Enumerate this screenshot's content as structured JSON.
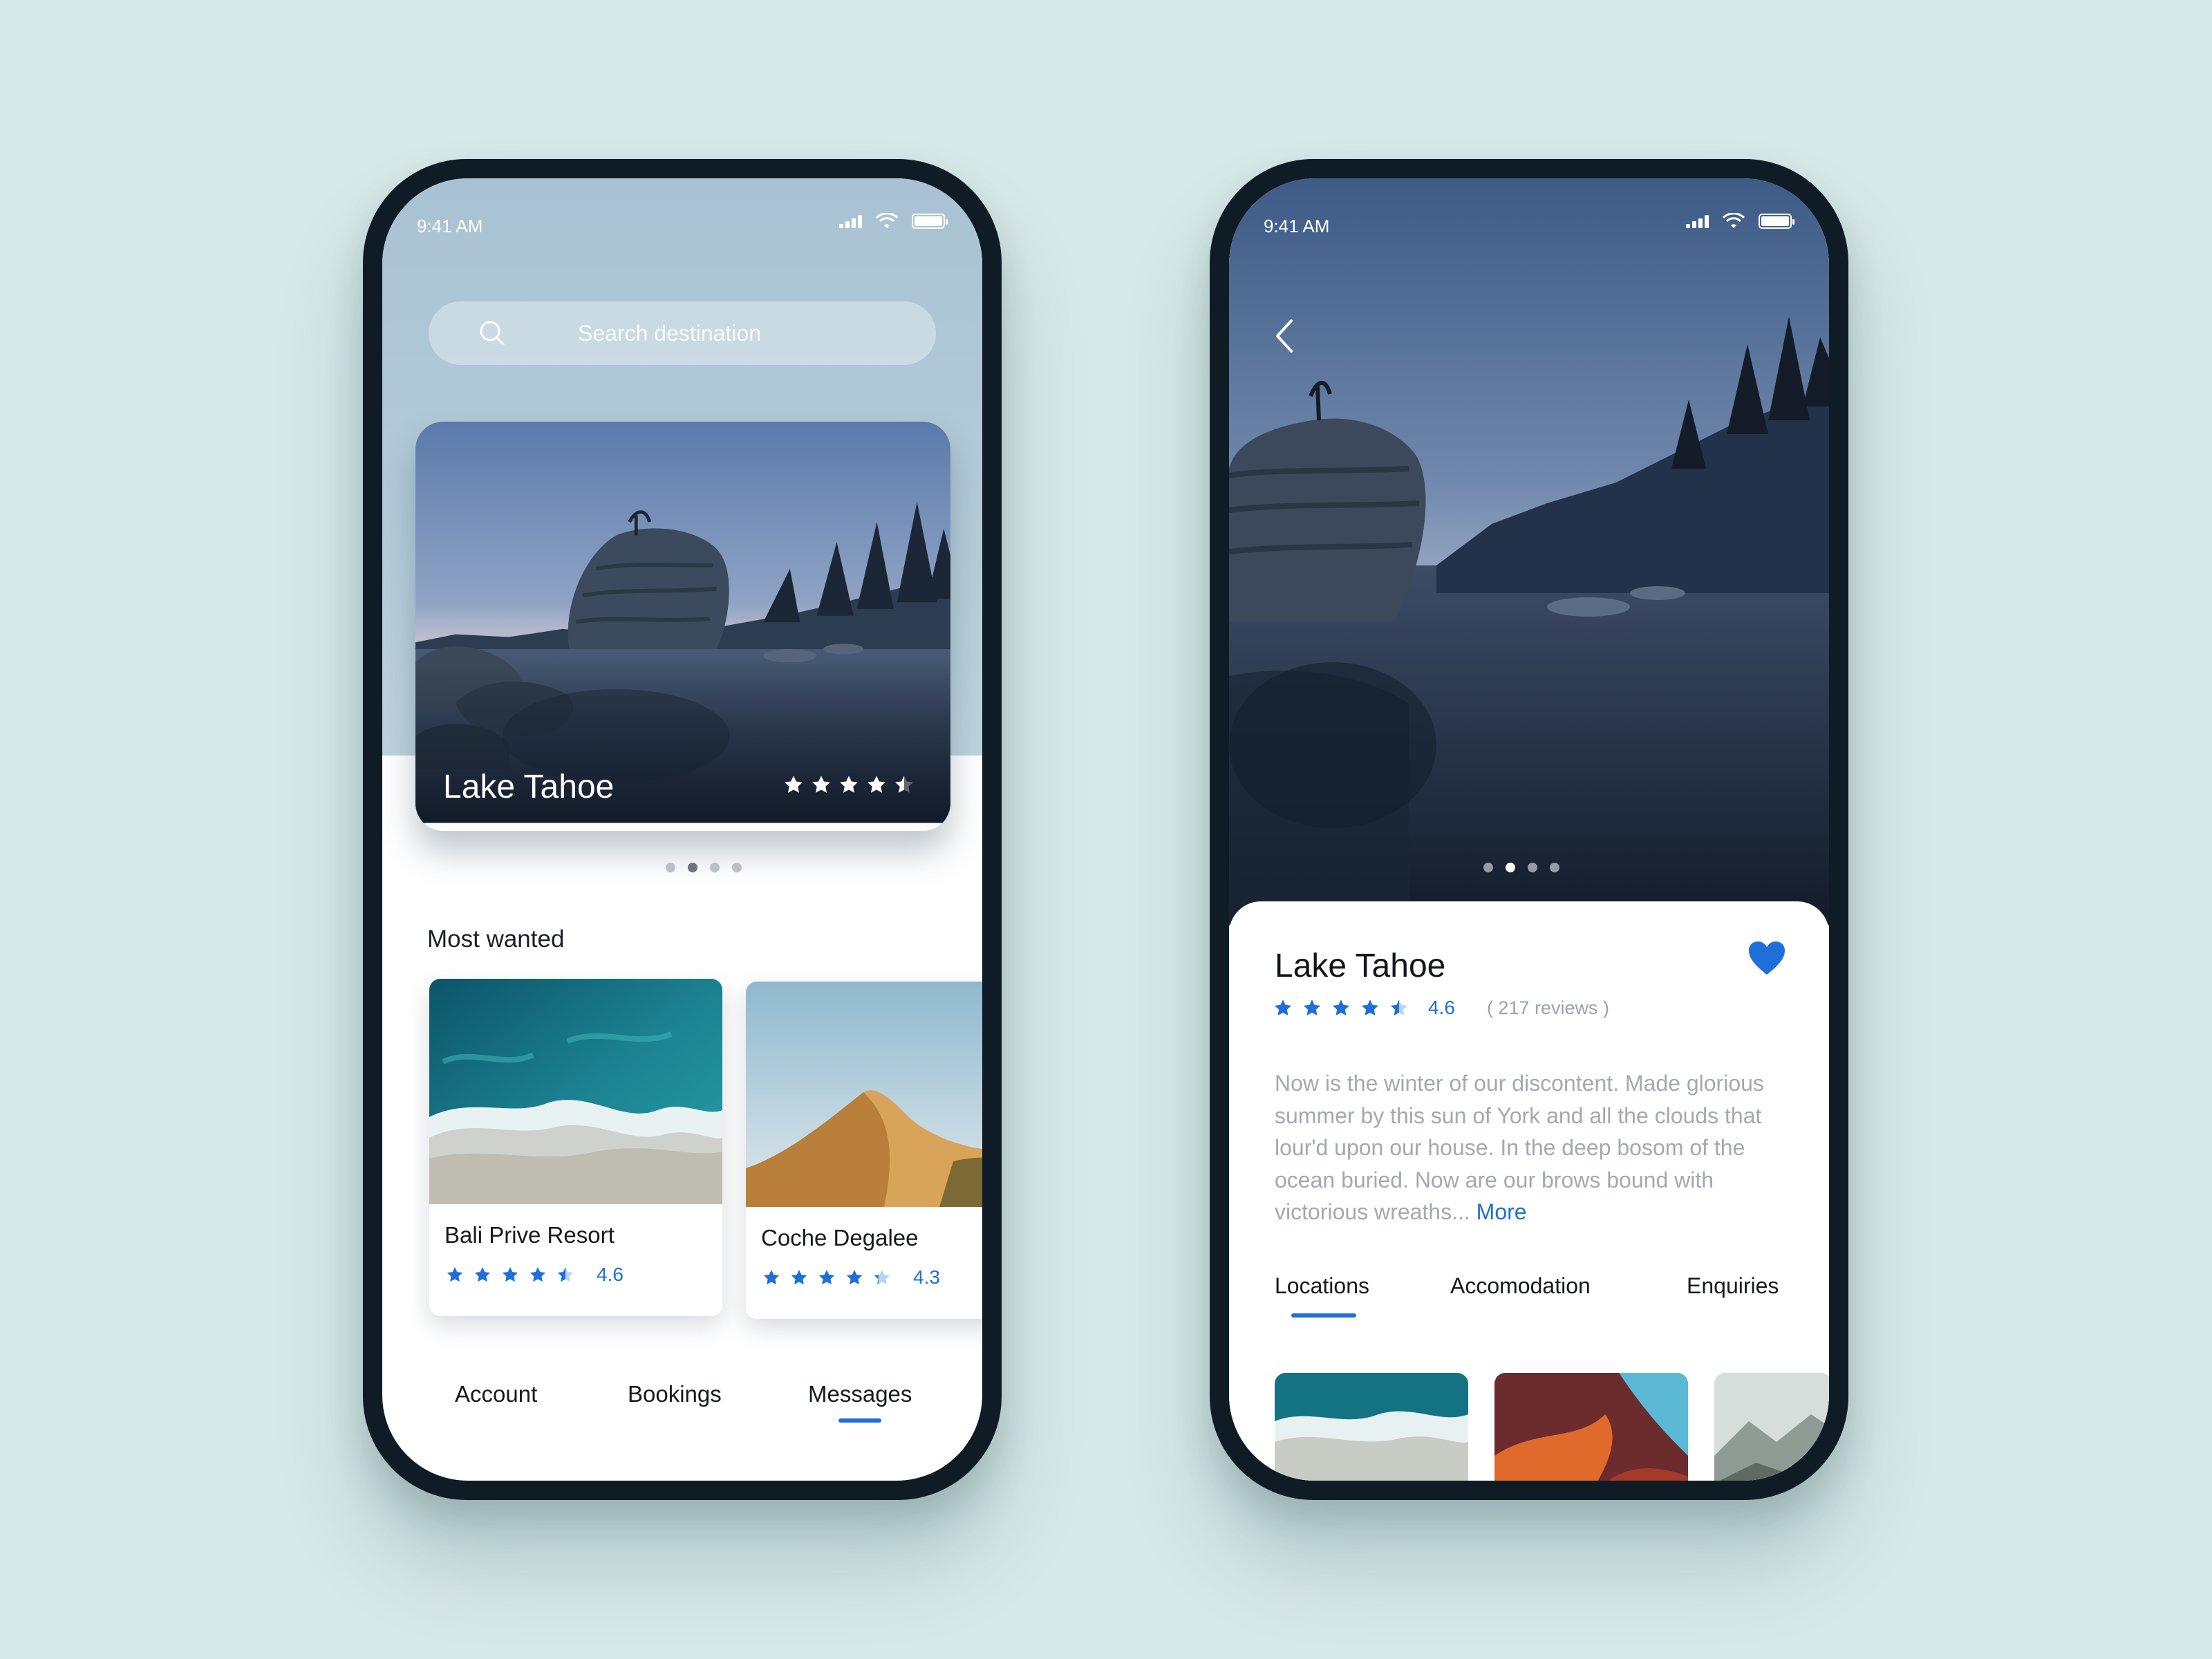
{
  "status": {
    "time": "9:41 AM"
  },
  "home": {
    "search": {
      "placeholder": "Search destination"
    },
    "featured": {
      "title": "Lake Tahoe",
      "rating_stars": 4.5
    },
    "carousel": {
      "count": 4,
      "active_index": 1
    },
    "section_title": "Most wanted",
    "cards": [
      {
        "name": "Bali Prive Resort",
        "rating": "4.6",
        "stars": 4.5
      },
      {
        "name": "Coche Degalee",
        "rating": "4.3",
        "stars": 4.3
      }
    ],
    "tabs": [
      {
        "label": "Account",
        "active": false
      },
      {
        "label": "Bookings",
        "active": false
      },
      {
        "label": "Messages",
        "active": true
      }
    ]
  },
  "detail": {
    "title": "Lake Tahoe",
    "rating": "4.6",
    "stars": 4.5,
    "reviews": "( 217 reviews )",
    "description": "Now is the winter of our discontent. Made glorious summer by this sun of York and all the clouds that lour'd upon our house. In the deep bosom of the ocean buried. Now are our brows bound with victorious wreaths... ",
    "more_label": "More",
    "favorited": true,
    "carousel": {
      "count": 4,
      "active_index": 1
    },
    "tabs": [
      {
        "label": "Locations",
        "active": true
      },
      {
        "label": "Accomodation",
        "active": false
      },
      {
        "label": "Enquiries",
        "active": false
      }
    ]
  },
  "colors": {
    "accent": "#1e6fd9",
    "background": "#d6e8e7",
    "phone_frame": "#0f1b25"
  }
}
